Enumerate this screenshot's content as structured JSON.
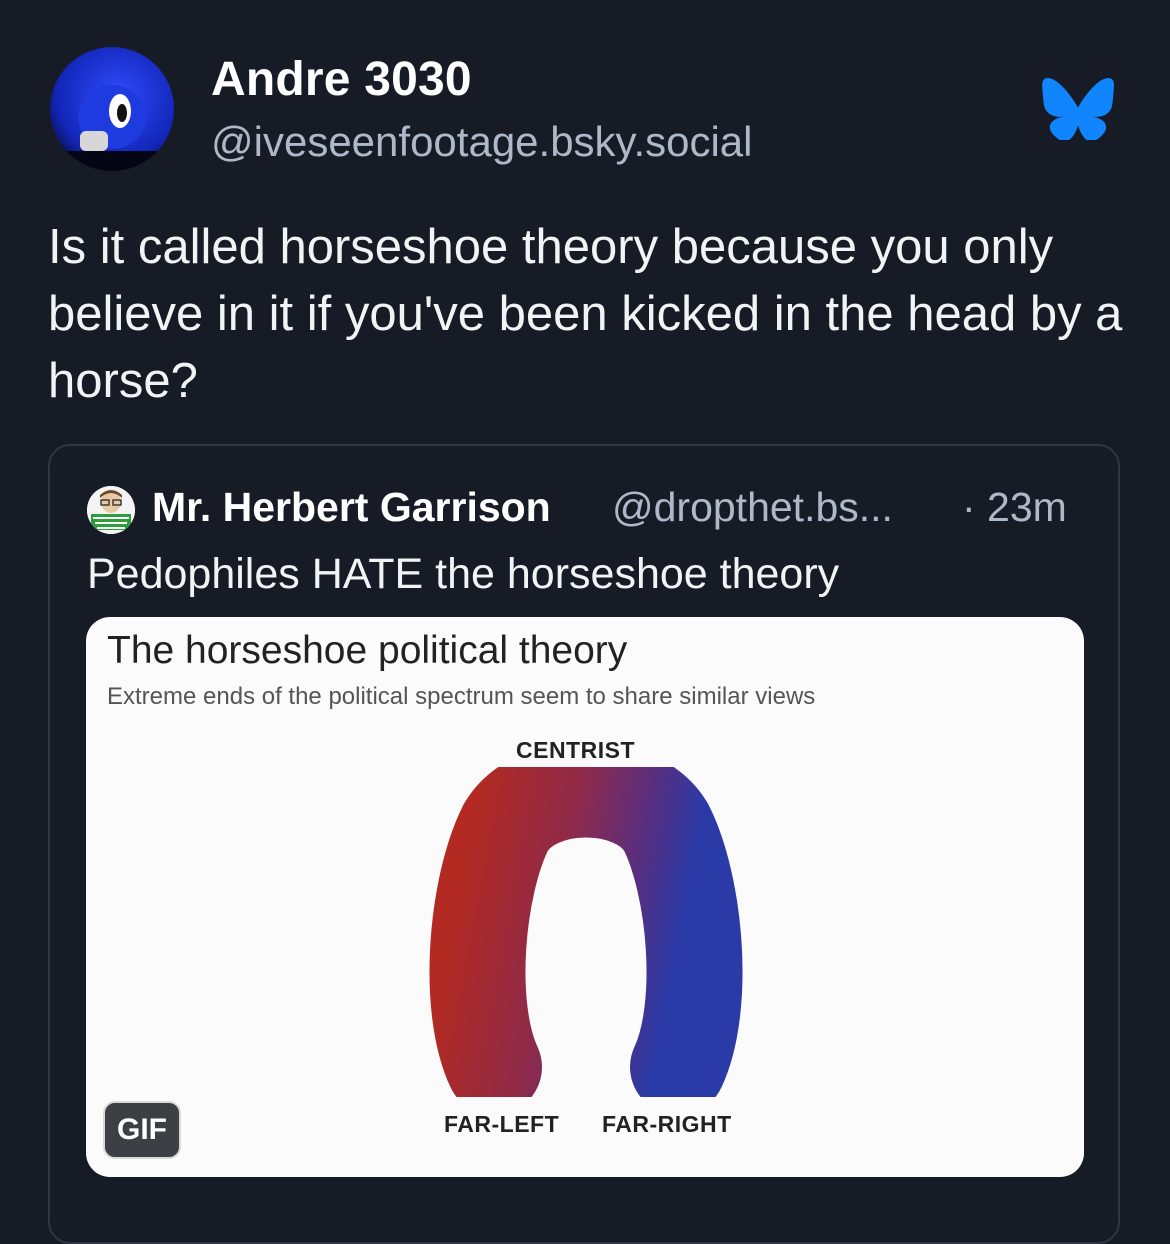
{
  "post": {
    "author_name": "Andre 3030",
    "author_handle": "@iveseenfootage.bsky.social",
    "text": "Is it called horseshoe theory because you only believe in it if you've been kicked in the head by a horse?"
  },
  "quote": {
    "author_name": "Mr. Herbert Garrison",
    "author_handle": "@dropthet.bs...",
    "time": "· 23m",
    "text": "Pedophiles HATE the horseshoe theory",
    "media": {
      "title": "The horseshoe political theory",
      "subtitle": "Extreme ends of the political spectrum seem to share similar views",
      "label_top": "CENTRIST",
      "label_left": "FAR-LEFT",
      "label_right": "FAR-RIGHT",
      "badge": "GIF"
    }
  },
  "icons": {
    "logo": "bluesky-butterfly-icon",
    "avatar": "user-avatar",
    "quote_avatar": "quoted-user-avatar"
  },
  "colors": {
    "background": "#161b26",
    "bluesky_blue": "#1185fe",
    "far_left": "#b22a22",
    "far_right": "#2a3aa6"
  }
}
